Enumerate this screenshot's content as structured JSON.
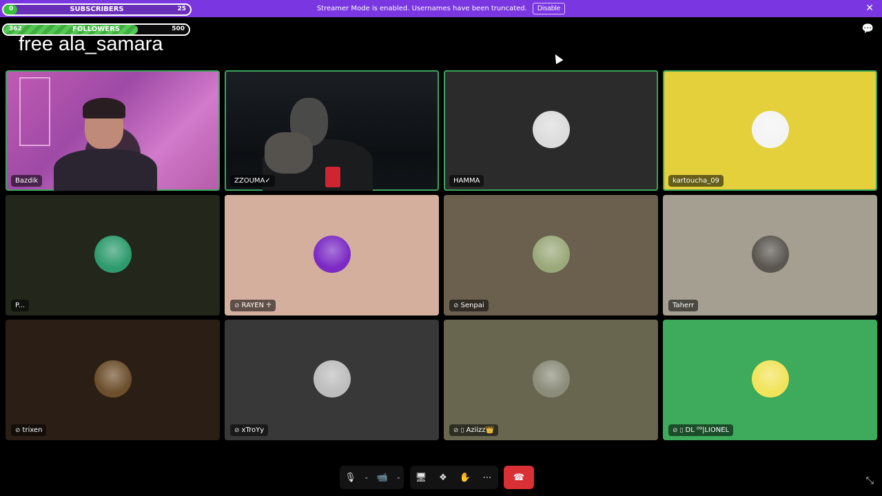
{
  "banner": {
    "message": "Streamer Mode is enabled. Usernames have been truncated.",
    "disable_label": "Disable",
    "close_icon": "✕",
    "color": "#7a36e0"
  },
  "overlay": {
    "subscribers": {
      "current": "0",
      "label": "SUBSCRIBERS",
      "goal": "25",
      "progress": 0.0
    },
    "followers": {
      "current": "362",
      "label": "FOLLOWERS",
      "goal": "500",
      "progress": 0.724
    },
    "title": "free ala_samara"
  },
  "icons": {
    "chat": "💬",
    "mic": "🎙",
    "chevron": "⌄",
    "camera": "📹",
    "screen_share": "🖥",
    "activities": "❖",
    "soundboard": "✋",
    "more": "⋯",
    "end_call": "☎",
    "fullscreen": "⤡",
    "muted": "⊘"
  },
  "participants": [
    {
      "name": "Bazdik",
      "speaking": true,
      "video": true,
      "bg": "#b85aad",
      "muted": false,
      "mobile": false
    },
    {
      "name": "ZZOUMA✓",
      "speaking": true,
      "video": true,
      "bg": "#12161a",
      "muted": false,
      "mobile": false
    },
    {
      "name": "HAMMA",
      "speaking": true,
      "video": false,
      "bg": "#2b2b2b",
      "avatar_bg": "#dcdcdc",
      "muted": false,
      "mobile": false
    },
    {
      "name": "kartoucha_09",
      "speaking": true,
      "video": false,
      "bg": "#e3d03b",
      "avatar_bg": "#f4f4f4",
      "muted": false,
      "mobile": false
    },
    {
      "name": "P...",
      "speaking": false,
      "video": false,
      "bg": "#23261b",
      "avatar_bg": "#2e9b6e",
      "muted": false,
      "mobile": false
    },
    {
      "name": "RAYEN ♱",
      "speaking": false,
      "video": false,
      "bg": "#d4af9e",
      "avatar_bg": "#7b2bc4",
      "muted": true,
      "mobile": false
    },
    {
      "name": "Senpai",
      "speaking": false,
      "video": false,
      "bg": "#6b5f4e",
      "avatar_bg": "#9aa97a",
      "muted": true,
      "mobile": false
    },
    {
      "name": "Taherr",
      "speaking": false,
      "video": false,
      "bg": "#a59f91",
      "avatar_bg": "#5a5650",
      "muted": false,
      "mobile": false
    },
    {
      "name": "trixen",
      "speaking": false,
      "video": false,
      "bg": "#2b1f15",
      "avatar_bg": "#6d4f2c",
      "muted": true,
      "mobile": false
    },
    {
      "name": "xTroYy",
      "speaking": false,
      "video": false,
      "bg": "#383838",
      "avatar_bg": "#bdbdbd",
      "muted": true,
      "mobile": false
    },
    {
      "name": "Aziizz👑",
      "speaking": false,
      "video": false,
      "bg": "#69664f",
      "avatar_bg": "#8b8c7a",
      "muted": true,
      "mobile": true
    },
    {
      "name": "DL ⁰⁹|LIONEL",
      "speaking": false,
      "video": false,
      "bg": "#3daa5c",
      "avatar_bg": "#f1e45a",
      "muted": true,
      "mobile": true
    }
  ],
  "controls": {
    "end_call_color": "#d93036"
  }
}
